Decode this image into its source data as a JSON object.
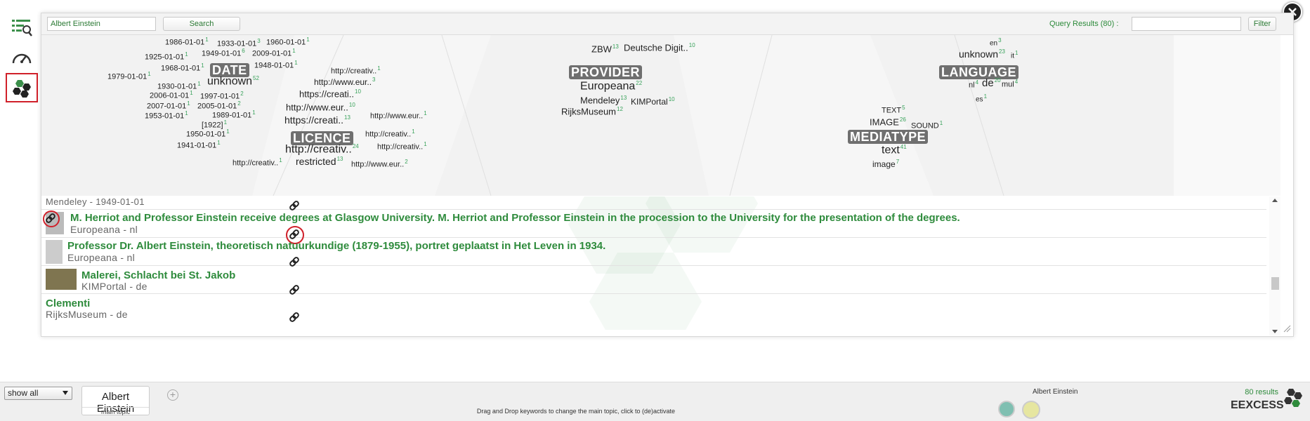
{
  "toolbar": {
    "search_value": "Albert Einstein",
    "search_button": "Search",
    "query_results": "Query Results (80) :",
    "filter_placeholder": "",
    "filter_button": "Filter"
  },
  "facets": {
    "categories": [
      "DATE",
      "LICENCE",
      "PROVIDER",
      "LANGUAGE",
      "MEDIATYPE"
    ],
    "date": [
      {
        "label": "1986-01-01",
        "count": "1"
      },
      {
        "label": "1933-01-01",
        "count": "3"
      },
      {
        "label": "1960-01-01",
        "count": "1"
      },
      {
        "label": "1925-01-01",
        "count": "1"
      },
      {
        "label": "1949-01-01",
        "count": "6"
      },
      {
        "label": "2009-01-01",
        "count": "1"
      },
      {
        "label": "1968-01-01",
        "count": "1"
      },
      {
        "label": "1948-01-01",
        "count": "1"
      },
      {
        "label": "1979-01-01",
        "count": "1"
      },
      {
        "label": "unknown",
        "count": "52"
      },
      {
        "label": "1930-01-01",
        "count": "1"
      },
      {
        "label": "2006-01-01",
        "count": "1"
      },
      {
        "label": "1997-01-01",
        "count": "2"
      },
      {
        "label": "2007-01-01",
        "count": "1"
      },
      {
        "label": "2005-01-01",
        "count": "2"
      },
      {
        "label": "1953-01-01",
        "count": "1"
      },
      {
        "label": "1989-01-01",
        "count": "1"
      },
      {
        "label": "[1922]",
        "count": "1"
      },
      {
        "label": "1950-01-01",
        "count": "1"
      },
      {
        "label": "1941-01-01",
        "count": "1"
      }
    ],
    "licence": [
      {
        "label": "http://creativ..",
        "count": "1"
      },
      {
        "label": "http://www.eur..",
        "count": "3"
      },
      {
        "label": "https://creati..",
        "count": "10"
      },
      {
        "label": "http://www.eur..",
        "count": "10"
      },
      {
        "label": "https://creati..",
        "count": "13"
      },
      {
        "label": "http://www.eur..",
        "count": "1"
      },
      {
        "label": "http://creativ..",
        "count": "1"
      },
      {
        "label": "http://creativ..",
        "count": "24"
      },
      {
        "label": "http://creativ..",
        "count": "1"
      },
      {
        "label": "http://creativ..",
        "count": "1"
      },
      {
        "label": "restricted",
        "count": "13"
      },
      {
        "label": "http://www.eur..",
        "count": "2"
      }
    ],
    "provider": [
      {
        "label": "ZBW",
        "count": "13"
      },
      {
        "label": "Deutsche Digit..",
        "count": "10"
      },
      {
        "label": "Europeana",
        "count": "22"
      },
      {
        "label": "Mendeley",
        "count": "13"
      },
      {
        "label": "KIMPortal",
        "count": "10"
      },
      {
        "label": "RijksMuseum",
        "count": "12"
      }
    ],
    "language": [
      {
        "label": "en",
        "count": "3"
      },
      {
        "label": "unknown",
        "count": "23"
      },
      {
        "label": "it",
        "count": "1"
      },
      {
        "label": "nl",
        "count": "4"
      },
      {
        "label": "de",
        "count": "20"
      },
      {
        "label": "mul",
        "count": "4"
      },
      {
        "label": "es",
        "count": "1"
      }
    ],
    "mediatype": [
      {
        "label": "TEXT",
        "count": "5"
      },
      {
        "label": "IMAGE",
        "count": "26"
      },
      {
        "label": "SOUND",
        "count": "1"
      },
      {
        "label": "text",
        "count": "41"
      },
      {
        "label": "image",
        "count": "7"
      }
    ]
  },
  "results": [
    {
      "title": "",
      "meta": "Mendeley - 1949-01-01"
    },
    {
      "title": "M. Herriot and Professor Einstein receive degrees at Glasgow University. M. Herriot and Professor Einstein in the procession to the University for the presentation of the degrees.",
      "meta": "Europeana - nl"
    },
    {
      "title": "Professor Dr. Albert Einstein, theoretisch natuurkundige (1879-1955), portret geplaatst in Het Leven in 1934.",
      "meta": "Europeana - nl"
    },
    {
      "title": "Malerei, Schlacht bei St. Jakob",
      "meta": "KIMPortal - de"
    },
    {
      "title": "Clementi",
      "meta": "RijksMuseum - de"
    }
  ],
  "bottom": {
    "show_select": "show all",
    "topic_name": "Albert Einstein",
    "topic_sub": "main topic",
    "hint": "Drag and Drop keywords to change the main topic, click to (de)activate",
    "query_label": "Albert Einstein",
    "results_count": "80 results",
    "brand": "EEXCESS"
  },
  "colors": {
    "accent_green": "#2e8b3c",
    "highlight_red": "#d0202a",
    "teal": "#7fbfb1",
    "yellow": "#e6e6a0"
  },
  "icons": [
    "search-list-icon",
    "gauge-icon",
    "hexagon-cluster-icon",
    "close-icon",
    "link-icon",
    "add-icon",
    "eexcess-logo-icon"
  ]
}
